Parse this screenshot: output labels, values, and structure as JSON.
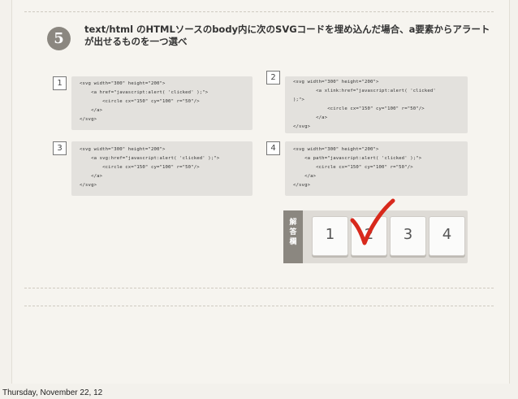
{
  "question": {
    "number": "5",
    "text": "text/html のHTMLソースのbody内に次のSVGコードを埋め込んだ場合、a要素からアラートが出せるものを一つ選べ"
  },
  "choices": [
    {
      "num": "1",
      "lines": [
        "<svg width=\"300\" height=\"200\">",
        "    <a href=\"javascript:alert( 'clicked' );\">",
        "        <circle cx=\"150\" cy=\"100\" r=\"50\"/>",
        "    </a>",
        "</svg>"
      ]
    },
    {
      "num": "2",
      "lines": [
        "<svg width=\"300\" height=\"200\">",
        "        <a xlink:href=\"javascript:alert( 'clicked'",
        ");\">",
        "            <circle cx=\"150\" cy=\"100\" r=\"50\"/>",
        "        </a>",
        "</svg>"
      ]
    },
    {
      "num": "3",
      "lines": [
        "<svg width=\"300\" height=\"200\">",
        "    <a svg:href=\"javascript:alert( 'clicked' );\">",
        "        <circle cx=\"150\" cy=\"100\" r=\"50\"/>",
        "    </a>",
        "</svg>"
      ]
    },
    {
      "num": "4",
      "lines": [
        "<svg width=\"300\" height=\"200\">",
        "    <a path=\"javascript:alert( 'clicked' );\">",
        "        <circle cx=\"150\" cy=\"100\" r=\"50\"/>",
        "    </a>",
        "</svg>"
      ]
    }
  ],
  "answer": {
    "label_chars": [
      "解",
      "答",
      "欄"
    ],
    "keys": [
      "1",
      "2",
      "3",
      "4"
    ],
    "checked_icon": "checkmark-icon",
    "check_color": "#d8291c"
  },
  "footer": "Thursday, November 22, 12"
}
